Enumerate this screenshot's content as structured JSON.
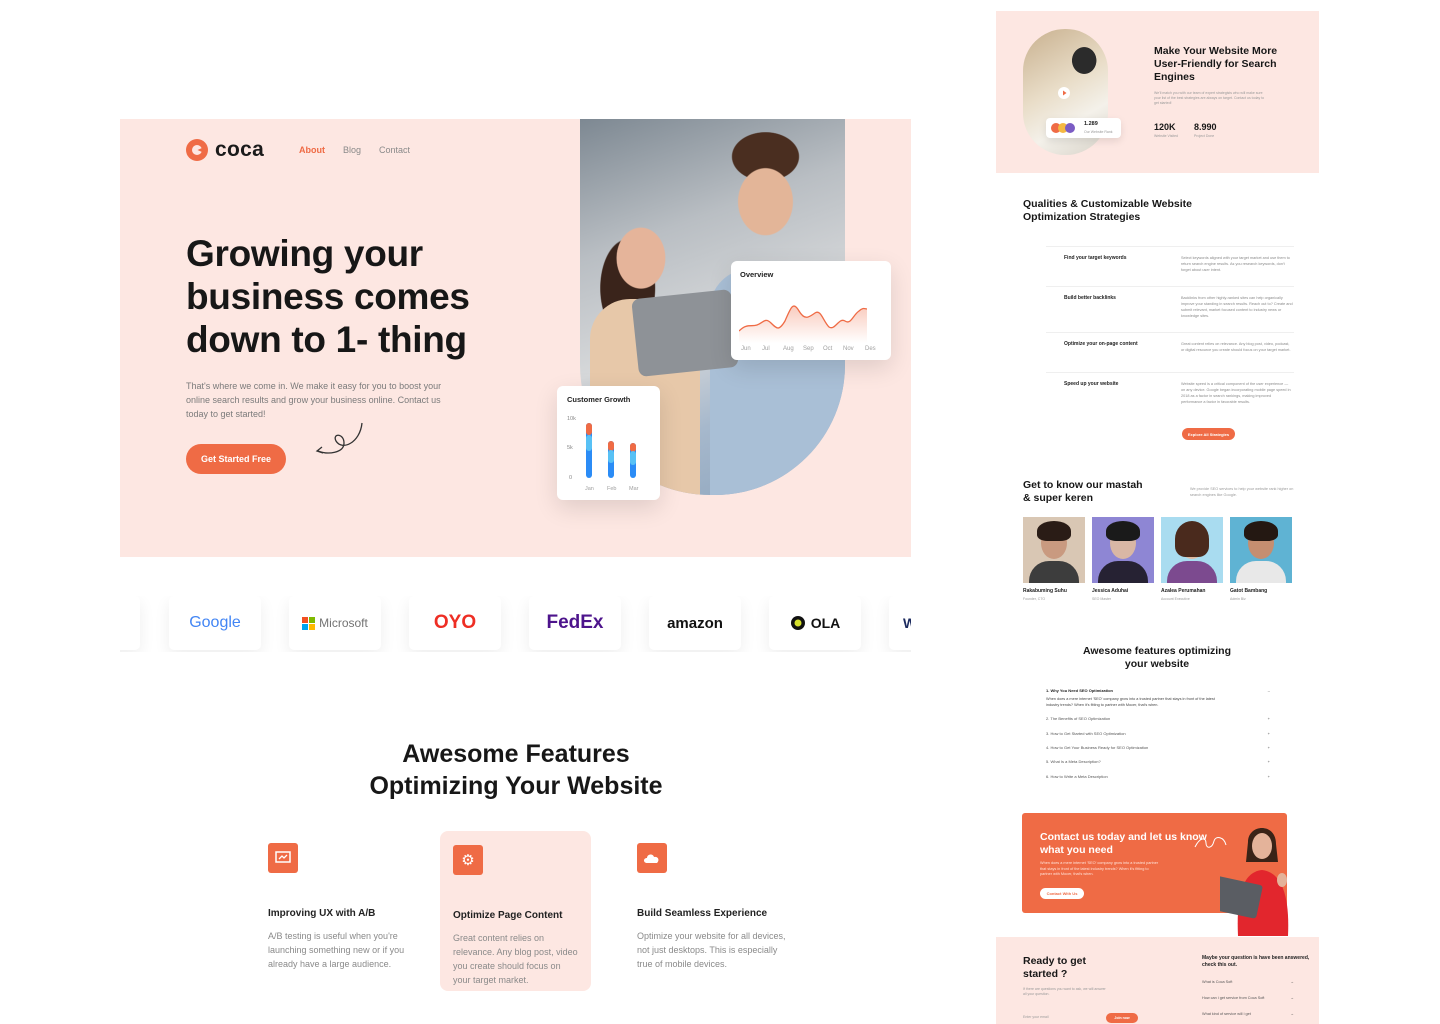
{
  "hero": {
    "brand": "coca",
    "nav": [
      "About",
      "Blog",
      "Contact"
    ],
    "title": "Growing your business comes down to 1- thing",
    "subtitle": "That's where we come in. We make it easy for you to boost your online search results and grow your business online. Contact us today to get started!",
    "cta": "Get Started Free",
    "overview": {
      "title": "Overview",
      "months": [
        "Jun",
        "Jul",
        "Aug",
        "Sep",
        "Oct",
        "Nov",
        "Des"
      ]
    },
    "growth": {
      "title": "Customer Growth",
      "ticks": [
        "10k",
        "5k",
        "0"
      ],
      "months": [
        "Jan",
        "Feb",
        "Mar"
      ]
    }
  },
  "logos": [
    "Google",
    "Microsoft",
    "OYO",
    "FedEx",
    "amazon",
    "OLA"
  ],
  "features": {
    "title_line1": "Awesome Features",
    "title_line2": "Optimizing Your Website",
    "items": [
      {
        "name": "Improving UX with A/B",
        "desc": "A/B testing is useful when you're launching something new or if you already have a large audience."
      },
      {
        "name": "Optimize Page Content",
        "desc": "Great content relies on relevance. Any blog post, video you create should focus on your target market."
      },
      {
        "name": "Build Seamless Experience",
        "desc": "Optimize your website for all devices, not just desktops. This is especially true of mobile devices."
      }
    ]
  },
  "right": {
    "seo": {
      "title": "Make Your Website More User-Friendly for Search Engines",
      "text": "We'll match you with our team of expert strategists who will make sure your list of the best strategies are always on target. Contact us today to get started!",
      "badge_value": "1.289",
      "badge_label": "Our Website Rank",
      "stats": [
        {
          "value": "120K",
          "label": "Website Visited"
        },
        {
          "value": "8.990",
          "label": "Project Done"
        }
      ]
    },
    "strategies": {
      "title": "Qualities & Customizable Website Optimization Strategies",
      "rows": [
        {
          "name": "Find your target keywords",
          "desc": "Select keywords aligned with your target market and use them to return search engine results. As you research keywords, don't forget about user intent."
        },
        {
          "name": "Build better backlinks",
          "desc": "Backlinks from other highly-ranked sites can help organically improve your standing in search results. Reach out to? Create and submit relevant, market focused content to industry news or knowledge sites."
        },
        {
          "name": "Optimize your on-page content",
          "desc": "Great content relies on relevance. Any blog post, video, podcast, or digital resource you create should focus on your target market."
        },
        {
          "name": "Speed up your website",
          "desc": "Website speed is a critical component of the user experience — on any device. Google began incorporating mobile page speed in 2018 as a factor in search rankings, making improved performance a factor in favorable results."
        }
      ],
      "button": "Explore All Strategies"
    },
    "team": {
      "title": "Get to know our mastah & super keren",
      "text": "We provide SEO services to help your website rank higher on search engines like Google.",
      "members": [
        {
          "name": "Rakabuming Suhu",
          "role": "Founder, CTO"
        },
        {
          "name": "Jessica Aduhai",
          "role": "SEO Master"
        },
        {
          "name": "Azalea Perumahan",
          "role": "Account Executive"
        },
        {
          "name": "Gatot Bambang",
          "role": "Admin Biz"
        }
      ]
    },
    "faq": {
      "title": "Awesome features optimizing your website",
      "open_q": "1. Why You Need SEO Optimization",
      "open_a": "When does a mere internet 'SEO' company grow into a trusted partner that stays in front of the latest industry trends? When it's fitting to partner with Mocer, that's when.",
      "items": [
        "2. The Benefits of SEO Optimization",
        "3. How to Get Started with SEO Optimization",
        "4. How to Get Your Business Ready for SEO Optimization",
        "5. What Is a Meta Description?",
        "6. How to Write a Meta Description"
      ]
    },
    "contact": {
      "title": "Contact us today and let us know what you need",
      "text": "When does a mere internet 'SEO' company grow into a trusted partner that stays in front of the latest industry trends? When it's fitting to partner with Mocer, that's when.",
      "button": "Contact With Us"
    },
    "ready": {
      "title": "Ready to get started ?",
      "text": "If there are questions you want to ask, we will answer all your question.",
      "input_placeholder": "Enter your email",
      "button": "Join now",
      "question_title": "Maybe your question is have been answered, check this out.",
      "links": [
        "What is Coca Soft",
        "How can i get service from Coca Soft",
        "What kind of service will i get"
      ]
    }
  },
  "colors": {
    "accent": "#ef6b45",
    "peach": "#fde7e2",
    "blue": "#2b8cf6"
  }
}
